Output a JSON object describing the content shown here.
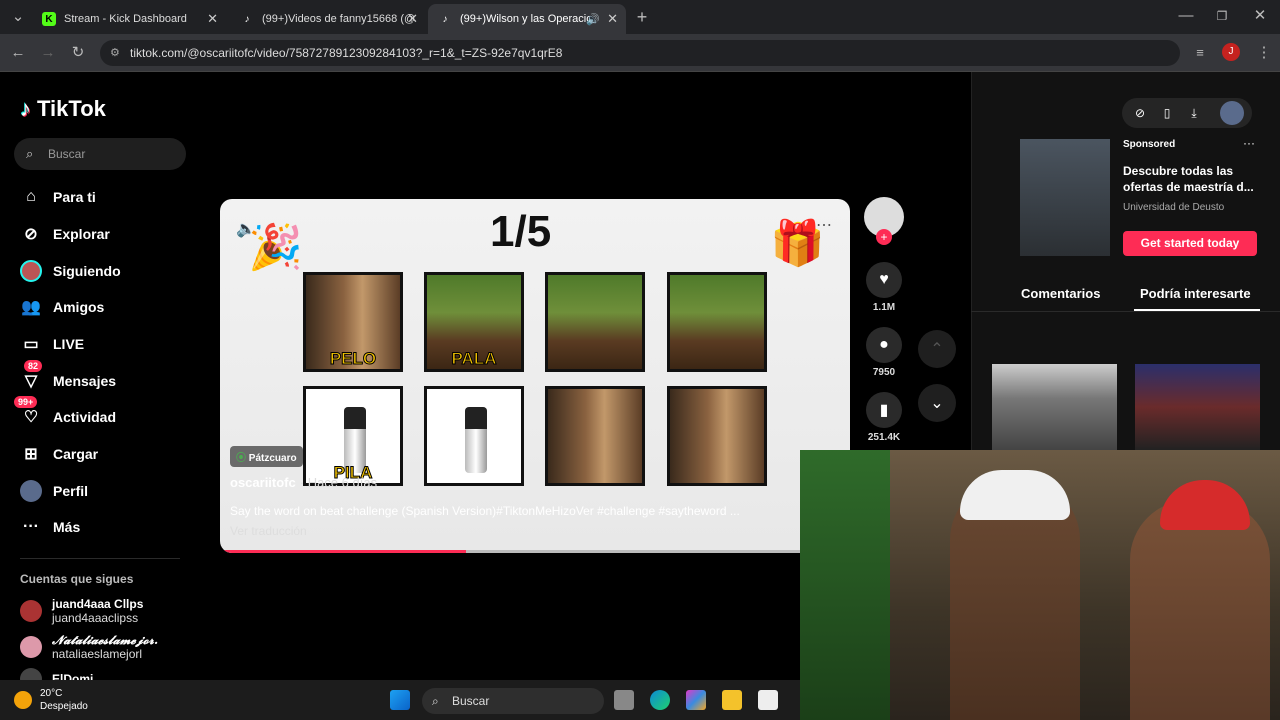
{
  "browser": {
    "tabs": [
      {
        "title": "Stream - Kick Dashboard",
        "icon": "kick-icon",
        "active": false
      },
      {
        "title": "(99+)Videos de fanny15668 (@",
        "icon": "tiktok-icon",
        "active": false
      },
      {
        "title": "(99+)Wilson y las Operacio",
        "icon": "tiktok-icon",
        "active": true
      }
    ],
    "url": "tiktok.com/@oscariitofc/video/7587278912309284103?_r=1&_t=ZS-92e7qv1qrE8"
  },
  "sidebar": {
    "logo_text": "TikTok",
    "search_placeholder": "Buscar",
    "nav": [
      {
        "label": "Para ti",
        "icon": "home-icon"
      },
      {
        "label": "Explorar",
        "icon": "compass-icon"
      },
      {
        "label": "Siguiendo",
        "icon": "following-avatar-icon"
      },
      {
        "label": "Amigos",
        "icon": "friends-icon"
      },
      {
        "label": "LIVE",
        "icon": "live-icon"
      },
      {
        "label": "Mensajes",
        "icon": "messages-icon",
        "badge": "82"
      },
      {
        "label": "Actividad",
        "icon": "activity-icon",
        "badge": "99+"
      },
      {
        "label": "Cargar",
        "icon": "upload-icon"
      },
      {
        "label": "Perfil",
        "icon": "profile-icon"
      },
      {
        "label": "Más",
        "icon": "more-icon"
      }
    ],
    "following_title": "Cuentas que sigues",
    "accounts": [
      {
        "name": "juand4aaa Cllps",
        "handle": "juand4aaaclipss"
      },
      {
        "name": "𝓝𝓪𝓽𝓪𝓵𝓲𝓪𝓮𝓼𝓵𝓪𝓶𝓮𝓳𝓸𝓻.",
        "handle": "nataliaeslamejorl"
      },
      {
        "name": "ElDomi",
        "handle": ""
      }
    ]
  },
  "video": {
    "counter": "1/5",
    "cards_top": [
      "PELO",
      "PALA",
      "",
      ""
    ],
    "cards_bottom": [
      "PILA",
      "",
      "",
      ""
    ],
    "location": "Pátzcuaro",
    "author": "oscariitofc",
    "posted": "· Hace 6 días",
    "caption": "Say the word on beat challenge (Spanish Version)#TiktonMeHizoVer #challenge #saytheword ...",
    "translate": "Ver traducción",
    "progress": 0.39
  },
  "actions": {
    "likes": "1.1M",
    "comments": "7950",
    "saves": "251.4K"
  },
  "right_panel": {
    "sponsored": "Sponsored",
    "ad_title": "Descubre todas las ofertas de maestría d...",
    "ad_advertiser": "Universidad de Deusto",
    "ad_cta": "Get started today",
    "tab_comments": "Comentarios",
    "tab_suggested": "Podría interesarte"
  },
  "taskbar": {
    "temp": "20°C",
    "weather": "Despejado",
    "search": "Buscar"
  },
  "colors": {
    "accent": "#fe2c55",
    "background": "#000000"
  }
}
